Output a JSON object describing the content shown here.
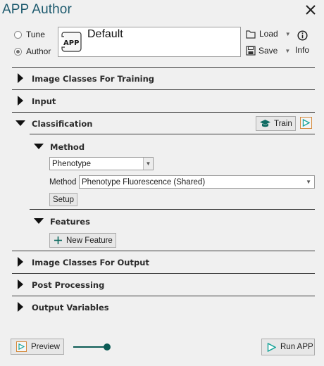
{
  "window": {
    "title": "APP Author"
  },
  "mode": {
    "tune_label": "Tune",
    "author_label": "Author",
    "selected": "Author"
  },
  "app": {
    "name": "Default",
    "icon_text": "APP"
  },
  "file": {
    "load_label": "Load",
    "save_label": "Save",
    "info_label": "Info"
  },
  "sections": {
    "image_classes_training": "Image Classes For Training",
    "input": "Input",
    "classification": "Classification",
    "image_classes_output": "Image Classes For Output",
    "post_processing": "Post Processing",
    "output_variables": "Output Variables"
  },
  "classification": {
    "train_label": "Train",
    "method": {
      "heading": "Method",
      "type_value": "Phenotype",
      "method_label": "Method",
      "method_value": "Phenotype Fluorescence  (Shared)",
      "setup_label": "Setup"
    },
    "features": {
      "heading": "Features",
      "new_feature_label": "New Feature"
    }
  },
  "footer": {
    "preview_label": "Preview",
    "run_label": "Run APP",
    "preview_slider_level": 1.0
  },
  "colors": {
    "title": "#1d5a6e",
    "accent_play": "#1aa59a",
    "accent_border": "#d58a3c",
    "slider": "#0c5b55"
  }
}
